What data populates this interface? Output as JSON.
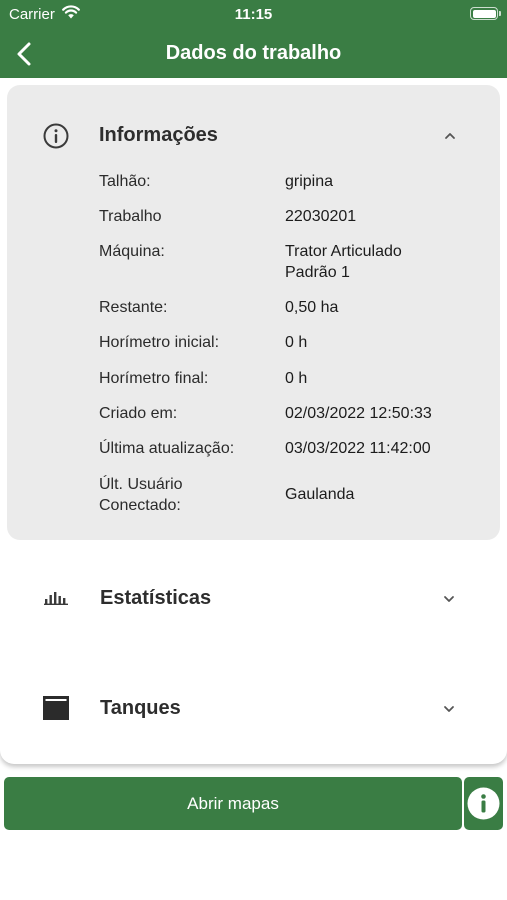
{
  "status_bar": {
    "carrier": "Carrier",
    "time": "11:15"
  },
  "nav": {
    "title": "Dados do trabalho",
    "back_icon": "chevron-left-icon"
  },
  "sections": {
    "info": {
      "title": "Informações",
      "icon": "info-circle-icon",
      "expanded": true,
      "rows": [
        {
          "label": "Talhão:",
          "value": "gripina"
        },
        {
          "label": "Trabalho",
          "value": "22030201"
        },
        {
          "label": "Máquina:",
          "value": "Trator Articulado Padrão  1"
        },
        {
          "label": "Restante:",
          "value": "0,50 ha"
        },
        {
          "label": "Horímetro inicial:",
          "value": "0 h"
        },
        {
          "label": "Horímetro final:",
          "value": "0 h"
        },
        {
          "label": "Criado em:",
          "value": "02/03/2022 12:50:33"
        },
        {
          "label": "Última atualização:",
          "value": "03/03/2022 11:42:00"
        },
        {
          "label": "Últ. Usuário Conectado:",
          "value": "Gaulanda"
        }
      ]
    },
    "stats": {
      "title": "Estatísticas",
      "icon": "bar-chart-icon",
      "expanded": false
    },
    "tanks": {
      "title": "Tanques",
      "icon": "tank-icon",
      "expanded": false
    }
  },
  "footer": {
    "open_maps_label": "Abrir mapas",
    "info_icon": "info-icon"
  },
  "colors": {
    "brand_green": "#3a7d44",
    "section_bg": "#ebebeb"
  }
}
